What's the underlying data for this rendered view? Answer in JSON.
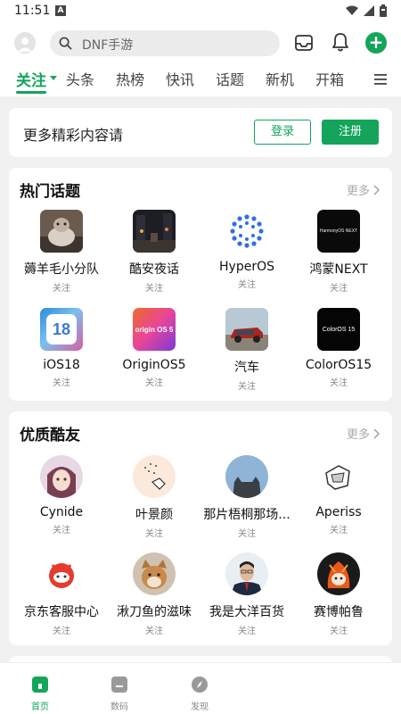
{
  "status": {
    "time": "11:51",
    "badge": "A"
  },
  "search": {
    "placeholder": "DNF手游"
  },
  "tabs": [
    {
      "label": "关注",
      "active": true
    },
    {
      "label": "头条"
    },
    {
      "label": "热榜"
    },
    {
      "label": "快讯"
    },
    {
      "label": "话题"
    },
    {
      "label": "新机"
    },
    {
      "label": "开箱"
    }
  ],
  "login_card": {
    "text": "更多精彩内容请",
    "login_label": "登录",
    "register_label": "注册"
  },
  "hot_topics": {
    "title": "热门话题",
    "more": "更多",
    "items": [
      {
        "name": "薅羊毛小分队",
        "sub": "关注",
        "icon": "sheep-photo"
      },
      {
        "name": "酷安夜话",
        "sub": "关注",
        "icon": "night-street-photo"
      },
      {
        "name": "HyperOS",
        "sub": "关注",
        "icon": "hyperos-logo"
      },
      {
        "name": "鸿蒙NEXT",
        "sub": "关注",
        "icon": "harmonyos-logo",
        "logo_text": "HarmonyOS NEXT"
      },
      {
        "name": "iOS18",
        "sub": "关注",
        "icon": "ios18-logo",
        "logo_text": "18"
      },
      {
        "name": "OriginOS5",
        "sub": "关注",
        "icon": "originos-logo",
        "logo_text": "origin OS 5"
      },
      {
        "name": "汽车",
        "sub": "关注",
        "icon": "car-photo"
      },
      {
        "name": "ColorOS15",
        "sub": "关注",
        "icon": "coloros-logo",
        "logo_text": "ColorOS 15"
      }
    ]
  },
  "quality_users": {
    "title": "优质酷友",
    "more": "更多",
    "items": [
      {
        "name": "Cynide",
        "sub": "关注",
        "icon": "anime-avatar"
      },
      {
        "name": "叶景颜",
        "sub": "关注",
        "icon": "cartoon-avatar"
      },
      {
        "name": "那片梧桐那场...",
        "sub": "关注",
        "icon": "cat-avatar"
      },
      {
        "name": "Aperiss",
        "sub": "关注",
        "icon": "sketch-avatar"
      },
      {
        "name": "京东客服中心",
        "sub": "关注",
        "icon": "jd-avatar"
      },
      {
        "name": "湫刀鱼的滋味",
        "sub": "关注",
        "icon": "dog-avatar"
      },
      {
        "name": "我是大洋百货",
        "sub": "关注",
        "icon": "man-avatar"
      },
      {
        "name": "赛博帕鲁",
        "sub": "关注",
        "icon": "cyber-avatar"
      }
    ]
  },
  "bottom_nav": [
    {
      "label": "首页",
      "icon": "home-icon",
      "active": true
    },
    {
      "label": "数码",
      "icon": "device-icon"
    },
    {
      "label": "发现",
      "icon": "compass-icon"
    }
  ],
  "colors": {
    "accent": "#14a45a",
    "background": "#f1f1f1"
  }
}
